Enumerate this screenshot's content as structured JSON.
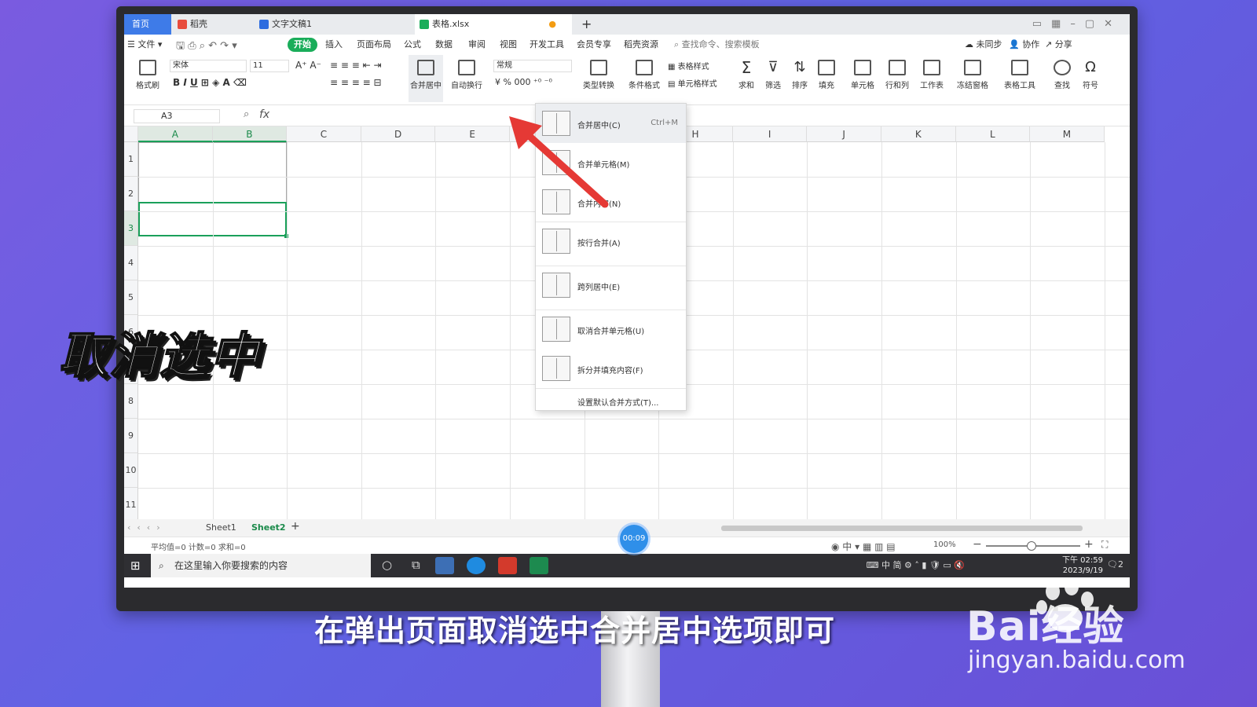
{
  "tabs": [
    {
      "label": "首页"
    },
    {
      "label": "稻壳"
    },
    {
      "label": "文字文稿1"
    },
    {
      "label": "表格.xlsx"
    }
  ],
  "tab_add": "+",
  "menubar": {
    "file": "文件",
    "items": [
      "开始",
      "插入",
      "页面布局",
      "公式",
      "数据",
      "审阅",
      "视图",
      "开发工具",
      "会员专享",
      "稻壳资源"
    ],
    "search": "查找命令、搜索模板",
    "sync": "未同步",
    "collab": "协作",
    "share": "分享"
  },
  "ribbon": {
    "format_painter": "格式刷",
    "font_name": "宋体",
    "font_size": "11",
    "number_format": "常规",
    "merge_center": "合并居中",
    "wrap_text": "自动换行",
    "convert": "类型转换",
    "cond_format": "条件格式",
    "table_style": "表格样式",
    "cell_style": "单元格样式",
    "sum": "求和",
    "filter": "筛选",
    "sort": "排序",
    "fill": "填充",
    "cell": "单元格",
    "row_col": "行和列",
    "worksheet": "工作表",
    "freeze": "冻结窗格",
    "table_tools": "表格工具",
    "find": "查找",
    "symbol": "符号"
  },
  "formula_bar": {
    "name_box": "A3",
    "fx": "fx"
  },
  "columns": [
    "A",
    "B",
    "C",
    "D",
    "E",
    "F",
    "G",
    "H",
    "I",
    "J",
    "K",
    "L",
    "M"
  ],
  "rows": [
    "1",
    "2",
    "3",
    "4",
    "5",
    "6",
    "7",
    "8",
    "9",
    "10",
    "11"
  ],
  "dropdown": {
    "items": [
      {
        "label": "合并居中(C)",
        "shortcut": "Ctrl+M"
      },
      {
        "label": "合并单元格(M)",
        "shortcut": ""
      },
      {
        "label": "合并内容(N)",
        "shortcut": ""
      },
      {
        "label": "按行合并(A)",
        "shortcut": ""
      },
      {
        "label": "跨列居中(E)",
        "shortcut": ""
      },
      {
        "label": "取消合并单元格(U)",
        "shortcut": ""
      },
      {
        "label": "拆分并填充内容(F)",
        "shortcut": ""
      }
    ],
    "footer": "设置默认合并方式(T)..."
  },
  "sheets": [
    "Sheet1",
    "Sheet2"
  ],
  "sheet_add": "+",
  "status": {
    "summary": "平均值=0  计数=0  求和=0",
    "zoom": "100%"
  },
  "taskbar": {
    "search_placeholder": "在这里输入你要搜索的内容",
    "tray": "中  简",
    "time": "下午 02:59",
    "date": "2023/9/19",
    "notif": "2"
  },
  "timer": "00:09",
  "overlay": {
    "caption": "取消选中",
    "subtitle": "在弹出页面取消选中合并居中选项即可",
    "watermark": "Bai经验",
    "watermark_url": "jingyan.baidu.com"
  },
  "colors": {
    "accent": "#1aad5a",
    "tab_home": "#3e7be8",
    "arrow": "#e53935",
    "timer": "#2f8fe9"
  }
}
